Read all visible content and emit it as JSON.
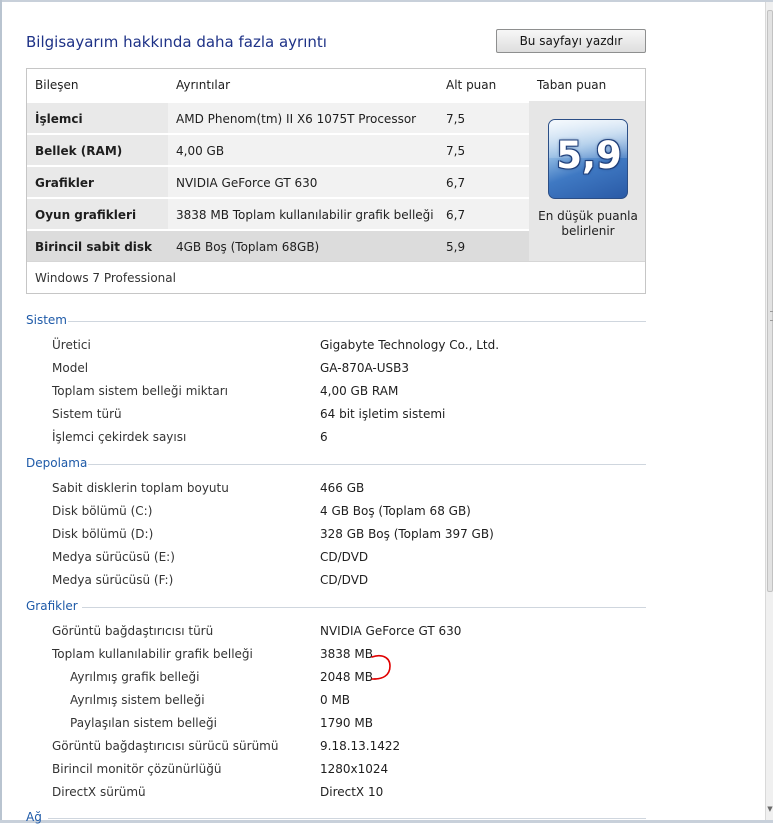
{
  "page": {
    "title": "Bilgisayarım hakkında daha fazla ayrıntı",
    "print_button": "Bu sayfayı yazdır"
  },
  "score_table": {
    "headers": {
      "component": "Bileşen",
      "details": "Ayrıntılar",
      "subscore": "Alt puan",
      "base_score": "Taban puan"
    },
    "rows": [
      {
        "component": "İşlemci",
        "details": "AMD Phenom(tm) II X6 1075T Processor",
        "subscore": "7,5"
      },
      {
        "component": "Bellek (RAM)",
        "details": "4,00 GB",
        "subscore": "7,5"
      },
      {
        "component": "Grafikler",
        "details": "NVIDIA GeForce GT 630",
        "subscore": "6,7"
      },
      {
        "component": "Oyun grafikleri",
        "details": "3838 MB Toplam kullanılabilir grafik belleği",
        "subscore": "6,7"
      },
      {
        "component": "Birincil sabit disk",
        "details": "4GB Boş (Toplam 68GB)",
        "subscore": "5,9"
      }
    ],
    "base_score": "5,9",
    "base_caption": "En düşük puanla belirlenir",
    "edition": "Windows 7 Professional"
  },
  "sections": {
    "system": {
      "title": "Sistem",
      "items": [
        {
          "label": "Üretici",
          "value": "Gigabyte Technology Co., Ltd."
        },
        {
          "label": "Model",
          "value": "GA-870A-USB3"
        },
        {
          "label": "Toplam sistem belleği miktarı",
          "value": "4,00 GB RAM"
        },
        {
          "label": "Sistem türü",
          "value": "64 bit işletim sistemi"
        },
        {
          "label": "İşlemci çekirdek sayısı",
          "value": "6"
        }
      ]
    },
    "storage": {
      "title": "Depolama",
      "items": [
        {
          "label": "Sabit disklerin toplam boyutu",
          "value": "466 GB"
        },
        {
          "label": "Disk bölümü (C:)",
          "value": "4 GB Boş (Toplam 68 GB)"
        },
        {
          "label": "Disk bölümü (D:)",
          "value": "328 GB Boş (Toplam 397 GB)"
        },
        {
          "label": "Medya sürücüsü (E:)",
          "value": "CD/DVD"
        },
        {
          "label": "Medya sürücüsü (F:)",
          "value": "CD/DVD"
        }
      ]
    },
    "graphics": {
      "title": "Grafikler",
      "items": [
        {
          "label": "Görüntü bağdaştırıcısı türü",
          "value": "NVIDIA GeForce GT 630"
        },
        {
          "label": "Toplam kullanılabilir grafik belleği",
          "value": "3838 MB"
        },
        {
          "label": "Ayrılmış grafik belleği",
          "value": "2048 MB"
        },
        {
          "label": "Ayrılmış sistem belleği",
          "value": "0 MB"
        },
        {
          "label": "Paylaşılan sistem belleği",
          "value": "1790 MB"
        },
        {
          "label": "Görüntü bağdaştırıcısı sürücü sürümü",
          "value": "9.18.13.1422"
        },
        {
          "label": "Birincil monitör çözünürlüğü",
          "value": "1280x1024"
        },
        {
          "label": "DirectX sürümü",
          "value": "DirectX 10"
        }
      ]
    },
    "network": {
      "title": "Ağ"
    }
  },
  "colors": {
    "title_blue": "#1e3287",
    "section_blue": "#1e5aa8",
    "annotation_red": "#e00000"
  }
}
